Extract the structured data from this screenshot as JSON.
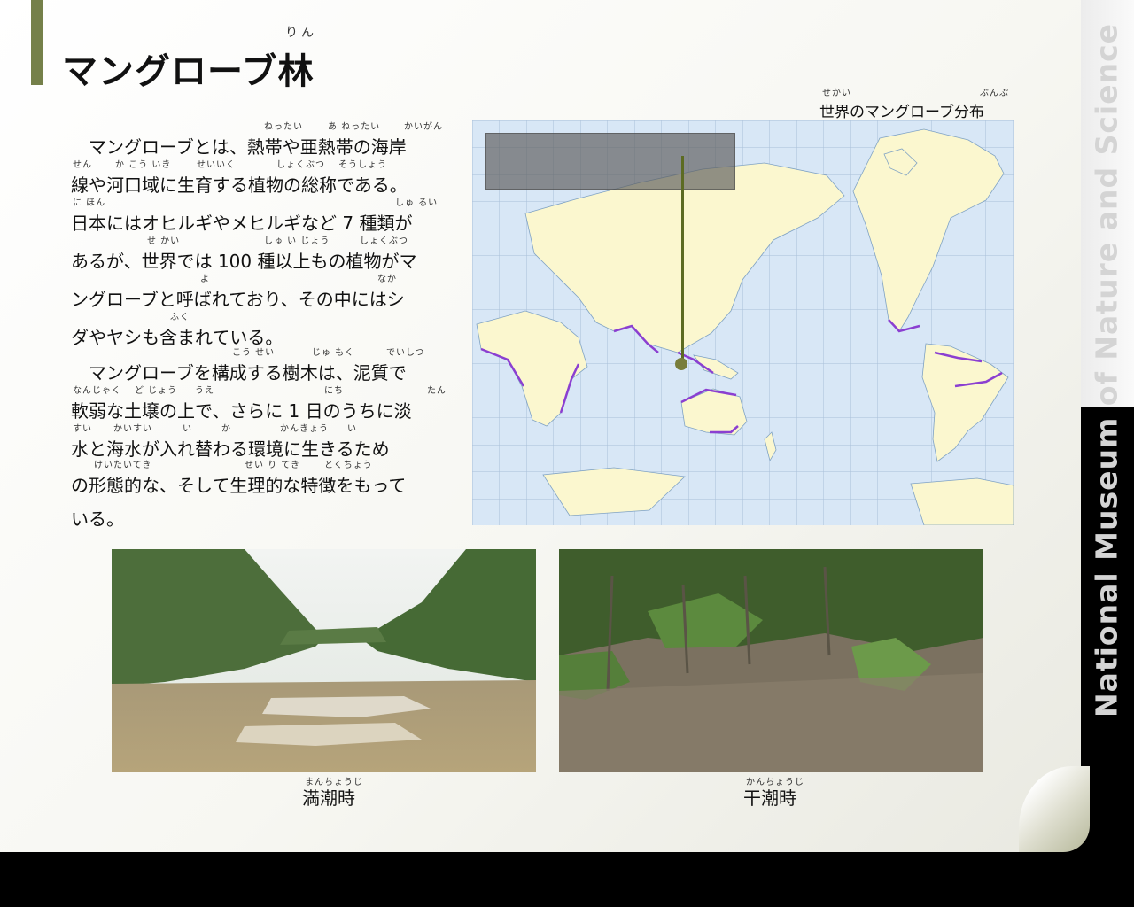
{
  "page": {
    "title": "マングローブ林",
    "title_ruby": "りん",
    "brand": "National Museum of Nature and Science"
  },
  "map": {
    "caption": "世界のマングローブ分布",
    "caption_ruby_1": "せかい",
    "caption_ruby_2": "ぶんぷ",
    "land_color": "#fbf7cf",
    "sea_color": "#d8e7f6",
    "mangrove_color": "#8b3fd1"
  },
  "text": {
    "lines": [
      "　マングローブとは、熱帯や亜熱帯の海岸",
      "線や河口域に生育する植物の総称である。",
      "日本にはオヒルギやメヒルギなど 7 種類が",
      "あるが、世界では 100 種以上もの植物がマ",
      "ングローブと呼ばれており、その中にはシ",
      "ダやヤシも含まれている。",
      "　マングローブを構成する樹木は、泥質で",
      "軟弱な土壌の上で、さらに 1 日のうちに淡",
      "水と海水が入れ替わる環境に生きるため",
      "の形態的な、そして生理的な特徴をもって",
      "いる。"
    ],
    "ruby": {
      "l1a": "ねったい",
      "l1b": "あ ねったい",
      "l1c": "かいがん",
      "l2a": "せん",
      "l2b": "か こう いき",
      "l2c": "せいいく",
      "l2d": "しょくぶつ",
      "l2e": "そうしょう",
      "l3a": "に ほん",
      "l3b": "しゅ るい",
      "l4a": "せ かい",
      "l4b": "しゅ い じょう",
      "l4c": "しょくぶつ",
      "l5a": "よ",
      "l5b": "なか",
      "l6a": "ふく",
      "l7a": "こう せい",
      "l7b": "じゅ もく",
      "l7c": "でいしつ",
      "l8a": "なんじゃく",
      "l8b": "ど じょう",
      "l8c": "うえ",
      "l8d": "にち",
      "l8e": "たん",
      "l9a": "すい",
      "l9b": "かいすい",
      "l9c": "い",
      "l9d": "か",
      "l9e": "かんきょう",
      "l9f": "い",
      "l10a": "けいたいてき",
      "l10b": "せい り てき",
      "l10c": "とくちょう"
    }
  },
  "photos": {
    "high_tide": {
      "caption": "満潮時",
      "ruby": "まんちょうじ"
    },
    "low_tide": {
      "caption": "干潮時",
      "ruby": "かんちょうじ"
    }
  }
}
